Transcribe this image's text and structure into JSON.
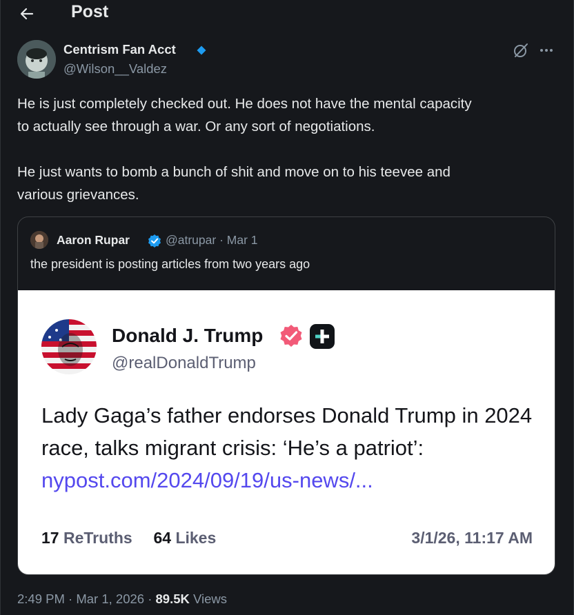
{
  "header": {
    "title": "Post"
  },
  "post": {
    "author": {
      "name": "Centrism Fan Acct",
      "handle": "@Wilson__Valdez"
    },
    "text": "He is just completely checked out. He does not have the mental capacity\nto actually see through a war. Or any sort of negotiations.\n\nHe just wants to bomb a bunch of shit and move on to his teevee and\nvarious grievances.",
    "quote": {
      "author_name": "Aaron Rupar",
      "meta": "@atrupar · Mar 1",
      "text": "the president is posting articles from two years ago",
      "image": {
        "name": "Donald J. Trump",
        "handle": "@realDonaldTrump",
        "body_text": "Lady Gaga’s father endorses Donald Trump in 2024 race, talks migrant crisis: ‘He’s a patriot’: ",
        "link": "nypost.com/2024/09/19/us-news/...",
        "retruths_count": "17",
        "retruths_label": "ReTruths",
        "likes_count": "64",
        "likes_label": "Likes",
        "date": "3/1/26, 11:17 AM"
      }
    },
    "footer": {
      "time_date": "2:49 PM · Mar 1, 2026 · ",
      "views_count": "89.5K",
      "views_label": " Views"
    }
  },
  "icons": {
    "back": "arrow-left-icon",
    "verified_author": "diamond-verified-icon",
    "grok": "grok-icon",
    "more": "more-horizontal-icon",
    "quote_verified": "blue-check-icon",
    "truth_verified": "pink-badge-icon",
    "truth_plus": "plus-badge-icon"
  },
  "colors": {
    "background": "#16181c",
    "text": "#e7e9ea",
    "muted": "#8b98a5",
    "verified_blue": "#1d9bf0",
    "truth_link": "#5448ee",
    "truth_badge": "#f25a78"
  }
}
